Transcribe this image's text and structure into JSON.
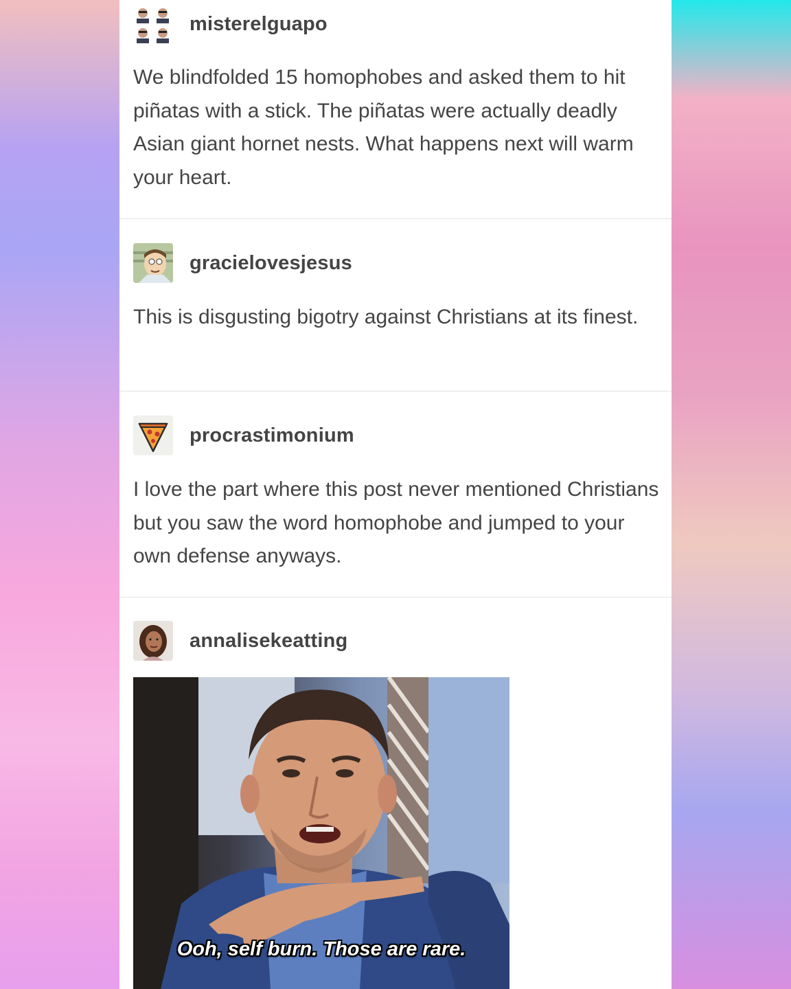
{
  "posts": [
    {
      "username": "misterelguapo",
      "avatar_icon": "four-faces-grid-avatar",
      "text": "We blindfolded 15 homophobes and asked them to hit piñatas with a stick. The piñatas were actually deadly Asian giant hornet nests. What happens next will warm your heart."
    },
    {
      "username": "gracielovesjesus",
      "avatar_icon": "cartoon-man-avatar",
      "text": "This is disgusting bigotry against Christians at its finest."
    },
    {
      "username": "procrastimonium",
      "avatar_icon": "pizza-slice-avatar",
      "text": "I love the part where this post never mentioned Christians but you saw the word homophobe and jumped to your own defense anyways."
    },
    {
      "username": "annalisekeatting",
      "avatar_icon": "woman-portrait-avatar",
      "gif_caption": "Ooh, self burn. Those are rare."
    }
  ],
  "colors": {
    "text": "#444444",
    "divider": "#e3e3e3",
    "panel": "#ffffff"
  }
}
